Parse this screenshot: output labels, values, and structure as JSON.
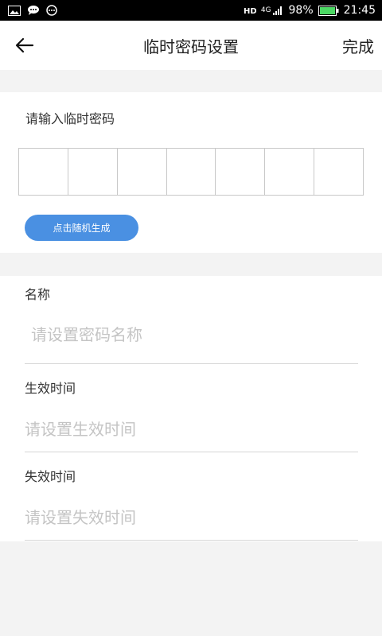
{
  "status_bar": {
    "battery_percent": "98%",
    "time": "21:45",
    "network": "4G"
  },
  "navbar": {
    "title": "临时密码设置",
    "done_label": "完成"
  },
  "password": {
    "label": "请输入临时密码",
    "box_count": 7,
    "random_button_label": "点击随机生成"
  },
  "form": {
    "name": {
      "label": "名称",
      "placeholder": "请设置密码名称"
    },
    "start_time": {
      "label": "生效时间",
      "placeholder": "请设置生效时间"
    },
    "end_time": {
      "label": "失效时间",
      "placeholder": "请设置失效时间"
    }
  },
  "colors": {
    "accent": "#4a90e2",
    "background": "#f3f3f3",
    "battery": "#4cd964"
  }
}
